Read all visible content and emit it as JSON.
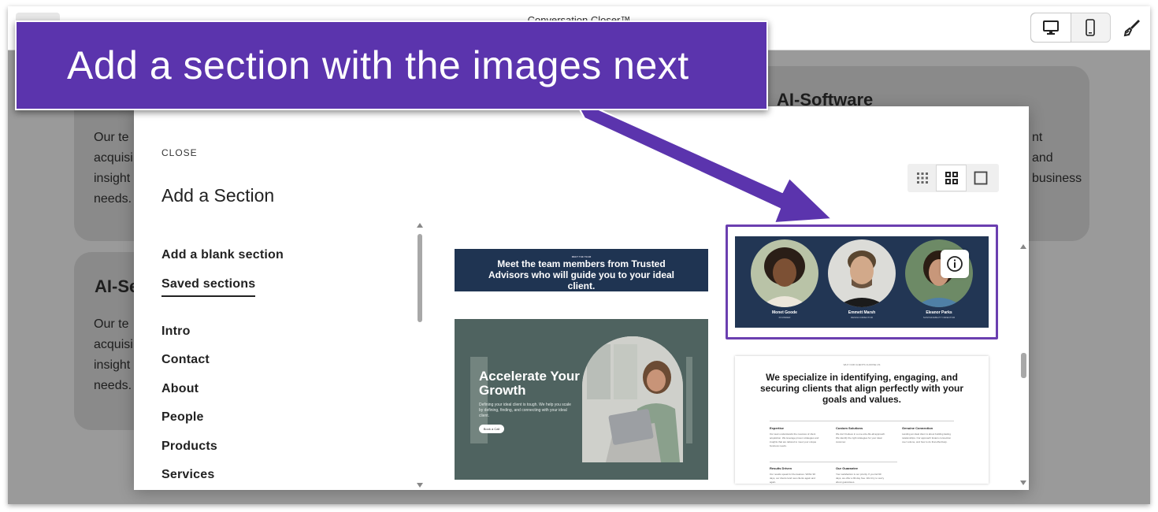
{
  "app": {
    "site_title": "Conversation Closer™"
  },
  "background": {
    "card_top_right_heading": "AI-Software",
    "card_left_heading": "AI-Se",
    "card_top_left_lines": [
      "Our te",
      "acquisi",
      "insight",
      "needs."
    ],
    "card_bottom_left_lines": [
      "Our te",
      "acquisi",
      "insight",
      "needs."
    ],
    "card_right_lines": [
      "nt",
      "and",
      "business"
    ]
  },
  "modal": {
    "close_label": "CLOSE",
    "title": "Add a Section",
    "add_blank": "Add a blank section",
    "saved_sections": "Saved sections",
    "categories": [
      "Intro",
      "Contact",
      "About",
      "People",
      "Products",
      "Services"
    ]
  },
  "thumbnails": {
    "team_banner": {
      "eyebrow": "MEET THE TEAM",
      "text": "Meet the team members from Trusted Advisors who will guide you to your ideal client."
    },
    "accelerate": {
      "title": "Accelerate Your Growth",
      "body": "Defining your ideal client is tough. We help you scale by defining, finding, and connecting with your ideal client.",
      "button": "Book a Call"
    },
    "team_photos": {
      "people": [
        {
          "name": "Monet Goode",
          "role": "FOUNDER"
        },
        {
          "name": "Emmett Marsh",
          "role": "DESIGN DIRECTOR"
        },
        {
          "name": "Eleanor Parks",
          "role": "SUSTAINABILITY DIRECTOR"
        }
      ]
    },
    "specialize": {
      "eyebrow": "WHY OUR CLIENTS CHOOSE US",
      "title": "We specialize in identifying, engaging, and securing clients that align perfectly with your goals and values.",
      "items": [
        {
          "head": "Expertise",
          "body": "Our team understands the nuances of client acquisition. We leverage proven strategies and insights that are tailored to meet your unique business needs."
        },
        {
          "head": "Custom Solutions",
          "body": "We don't believe in a one-size-fits-all approach. We identify the right strategies for your ideal customer."
        },
        {
          "head": "Genuine Connection",
          "body": "Landing an ideal client is about building lasting relationships. Our approach fosters connection over volume, and how to do that effectively."
        },
        {
          "head": "Results Driven",
          "body": "Our results speak for themselves. Within 90 days, our clients land new clients again and again."
        },
        {
          "head": "Our Guarantee",
          "body": "Your satisfaction is our priority. If you fail 90 days, we offer a 90-day free. We'd try to worry about guarantees."
        }
      ]
    }
  },
  "annotation": {
    "callout_text": "Add a section with the images next",
    "callout_color": "#5b34ad",
    "highlight_color": "#6b3fb0"
  },
  "icons": {
    "desktop": "desktop-icon",
    "mobile": "mobile-icon",
    "brush": "paint-brush-icon",
    "grid_small": "grid-small-icon",
    "grid_large": "grid-large-icon",
    "single": "single-view-icon",
    "info": "info-icon"
  }
}
